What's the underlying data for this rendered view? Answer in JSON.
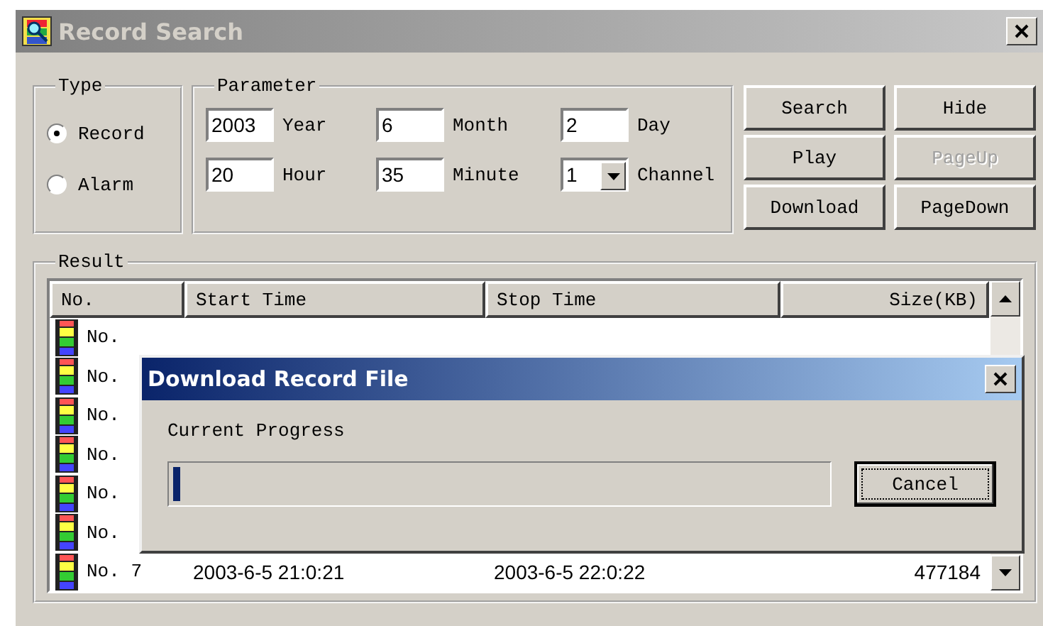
{
  "window": {
    "title": "Record Search"
  },
  "type": {
    "label": "Type",
    "options": [
      {
        "label": "Record",
        "selected": true
      },
      {
        "label": "Alarm",
        "selected": false
      }
    ]
  },
  "parameter": {
    "label": "Parameter",
    "fields": [
      {
        "kind": "text",
        "value": "2003",
        "unit": "Year"
      },
      {
        "kind": "text",
        "value": "6",
        "unit": "Month"
      },
      {
        "kind": "text",
        "value": "2",
        "unit": "Day"
      },
      {
        "kind": "text",
        "value": "20",
        "unit": "Hour"
      },
      {
        "kind": "text",
        "value": "35",
        "unit": "Minute"
      },
      {
        "kind": "dropdown",
        "value": "1",
        "unit": "Channel"
      }
    ]
  },
  "buttons": [
    {
      "label": "Search",
      "disabled": false
    },
    {
      "label": "Hide",
      "disabled": false
    },
    {
      "label": "Play",
      "disabled": false
    },
    {
      "label": "PageUp",
      "disabled": true
    },
    {
      "label": "Download",
      "disabled": false
    },
    {
      "label": "PageDown",
      "disabled": false
    }
  ],
  "result": {
    "label": "Result",
    "columns": [
      "No.",
      "Start Time",
      "Stop Time",
      "Size(KB)"
    ],
    "rows": [
      {
        "no": "No."
      },
      {
        "no": "No."
      },
      {
        "no": "No."
      },
      {
        "no": "No."
      },
      {
        "no": "No."
      },
      {
        "no": "No."
      },
      {
        "no": "No. 7",
        "start": "2003-6-5 21:0:21",
        "stop": "2003-6-5 22:0:22",
        "size": "477184"
      }
    ]
  },
  "dialog": {
    "title": "Download Record File",
    "label": "Current Progress",
    "level": 0.01,
    "button": "Cancel"
  }
}
